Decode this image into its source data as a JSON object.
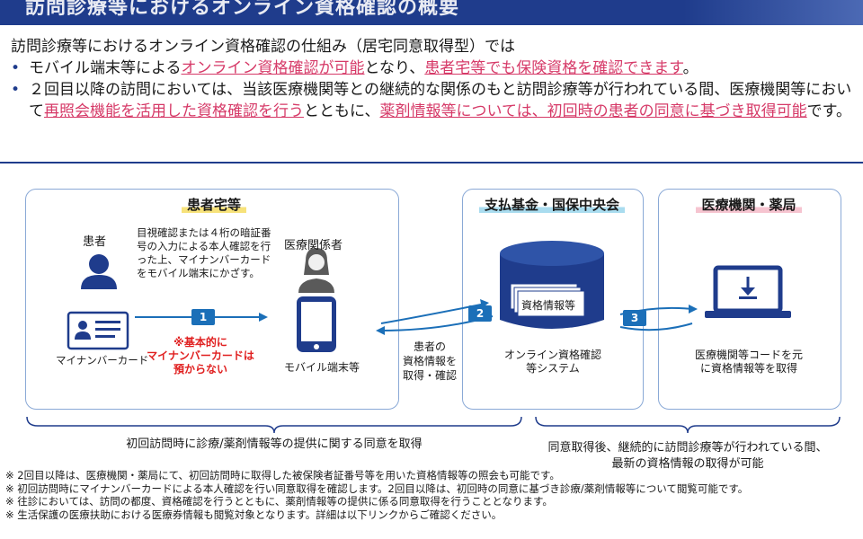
{
  "header": {
    "title": "訪問診療等におけるオンライン資格確認の概要"
  },
  "intro": {
    "heading": "訪問診療等におけるオンライン資格確認の仕組み（居宅同意取得型）では",
    "bullet1": {
      "t1": "モバイル端末等による",
      "h1": "オンライン資格確認が可能",
      "t2": "となり、",
      "h2": "患者宅等でも保険資格を確認できます",
      "t3": "。"
    },
    "bullet2": {
      "t1": "２回目以降の訪問においては、当該医療機関等との継続的な関係のもと訪問診療等が行われている間、医療機関等において",
      "h1": "再照会機能を活用した資格確認を行う",
      "t2": "とともに、",
      "h2": "薬剤情報等については、初回時の患者の同意に基づき取得可能",
      "t3": "です。"
    },
    "bullet_mark": "•"
  },
  "diagram": {
    "patient_home": {
      "title": "患者宅等",
      "patient_label": "患者",
      "card_label": "マイナンバーカード",
      "note": "目視確認または４桁の暗証番号の入力による本人確認を行った上、マイナンバーカードをモバイル端末にかざす。",
      "warning": "※基本的に\nマイナンバーカードは\n預からない",
      "staff_label": "医療関係者",
      "device_label": "モバイル端末等"
    },
    "fund": {
      "title": "支払基金・国保中央会",
      "db_label": "資格情報等",
      "system_label": "オンライン資格確認\n等システム"
    },
    "clinic": {
      "title": "医療機関・薬局",
      "desc": "医療機関等コードを元\nに資格情報等を取得"
    },
    "exchange_label": "患者の\n資格情報を\n取得・確認",
    "steps": [
      "1",
      "2",
      "3"
    ],
    "bracket_left": "初回訪問時に診療/薬剤情報等の提供に関する同意を取得",
    "bracket_right": "同意取得後、継続的に訪問診療等が行われている間、\n最新の資格情報の取得が可能"
  },
  "footnotes": [
    "※ 2回目以降は、医療機関・薬局にて、初回訪問時に取得した被保険者証番号等を用いた資格情報等の照会も可能です。",
    "※ 初回訪問時にマイナンバーカードによる本人確認を行い同意取得を確認します。2回目以降は、初回時の同意に基づき診療/薬剤情報等について閲覧可能です。",
    "※ 往診においては、訪問の都度、資格確認を行うとともに、薬剤情報等の提供に係る同意取得を行うこととなります。",
    "※ 生活保護の医療扶助における医療券情報も閲覧対象となります。詳細は以下リンクからご確認ください。"
  ],
  "colors": {
    "navy": "#1f3c8c",
    "accent_pink": "#d63a68",
    "step_blue": "#1b6fb8",
    "warning_red": "#e02020"
  }
}
